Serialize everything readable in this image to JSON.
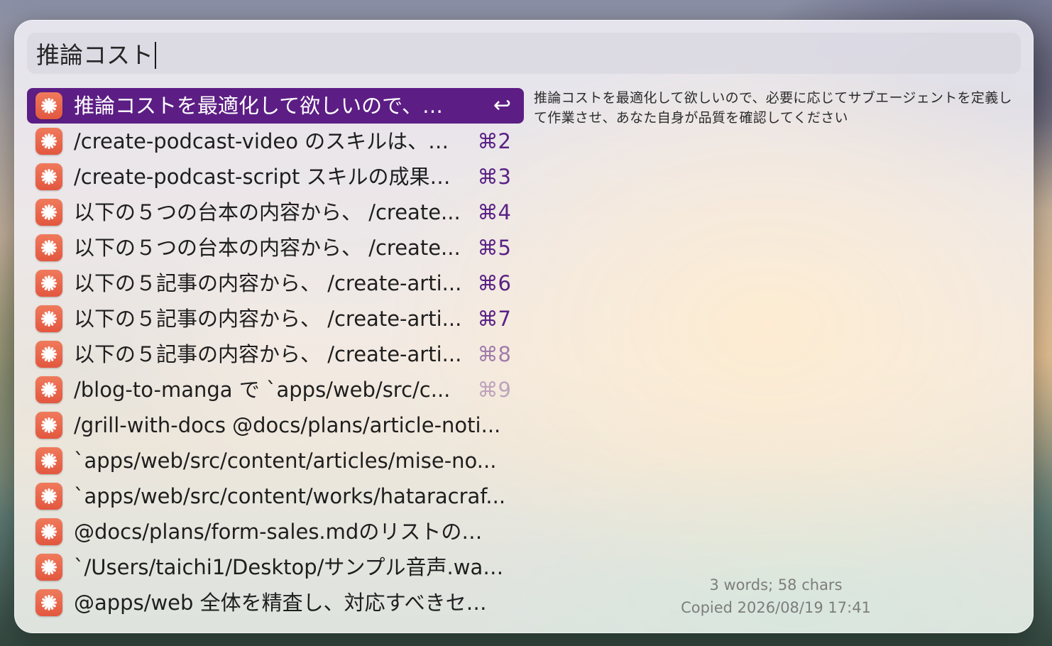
{
  "search": {
    "query": "推論コスト"
  },
  "preview": {
    "text": "推論コストを最適化して欲しいので、必要に応じてサブエージェントを定義して作業させ、あなた自身が品質を確認してください",
    "word_count": "3 words; 58 chars",
    "copied_at": "Copied 2026/08/19 17:41"
  },
  "colors": {
    "selection": "#5c1e84",
    "shortcut": "#5a2285",
    "app_icon": "#e8603f"
  },
  "items": [
    {
      "label": "推論コストを最適化して欲しいので、…",
      "shortcut": "↩",
      "icon": "claude-app-icon",
      "selected": true
    },
    {
      "label": "/create-podcast-video のスキルは、…",
      "shortcut": "⌘2",
      "icon": "claude-app-icon"
    },
    {
      "label": "/create-podcast-script スキルの成果…",
      "shortcut": "⌘3",
      "icon": "claude-app-icon"
    },
    {
      "label": "以下の５つの台本の内容から、 /create...",
      "shortcut": "⌘4",
      "icon": "claude-app-icon"
    },
    {
      "label": "以下の５つの台本の内容から、 /create...",
      "shortcut": "⌘5",
      "icon": "claude-app-icon"
    },
    {
      "label": "以下の５記事の内容から、 /create-arti...",
      "shortcut": "⌘6",
      "icon": "claude-app-icon"
    },
    {
      "label": "以下の５記事の内容から、 /create-arti...",
      "shortcut": "⌘7",
      "icon": "claude-app-icon"
    },
    {
      "label": "以下の５記事の内容から、 /create-arti...",
      "shortcut": "⌘8",
      "icon": "claude-app-icon"
    },
    {
      "label": "/blog-to-manga で `apps/web/src/c...",
      "shortcut": "⌘9",
      "icon": "claude-app-icon"
    },
    {
      "label": "/grill-with-docs @docs/plans/article-noti...",
      "shortcut": "",
      "icon": "claude-app-icon"
    },
    {
      "label": "`apps/web/src/content/articles/mise-no...",
      "shortcut": "",
      "icon": "claude-app-icon"
    },
    {
      "label": "`apps/web/src/content/works/hataracraf...",
      "shortcut": "",
      "icon": "claude-app-icon"
    },
    {
      "label": "@docs/plans/form-sales.mdのリストの…",
      "shortcut": "",
      "icon": "claude-app-icon"
    },
    {
      "label": "`/Users/taichi1/Desktop/サンプル音声.wa…",
      "shortcut": "",
      "icon": "claude-app-icon"
    },
    {
      "label": "@apps/web 全体を精査し、対応すべきセ…",
      "shortcut": "",
      "icon": "claude-app-icon"
    }
  ]
}
